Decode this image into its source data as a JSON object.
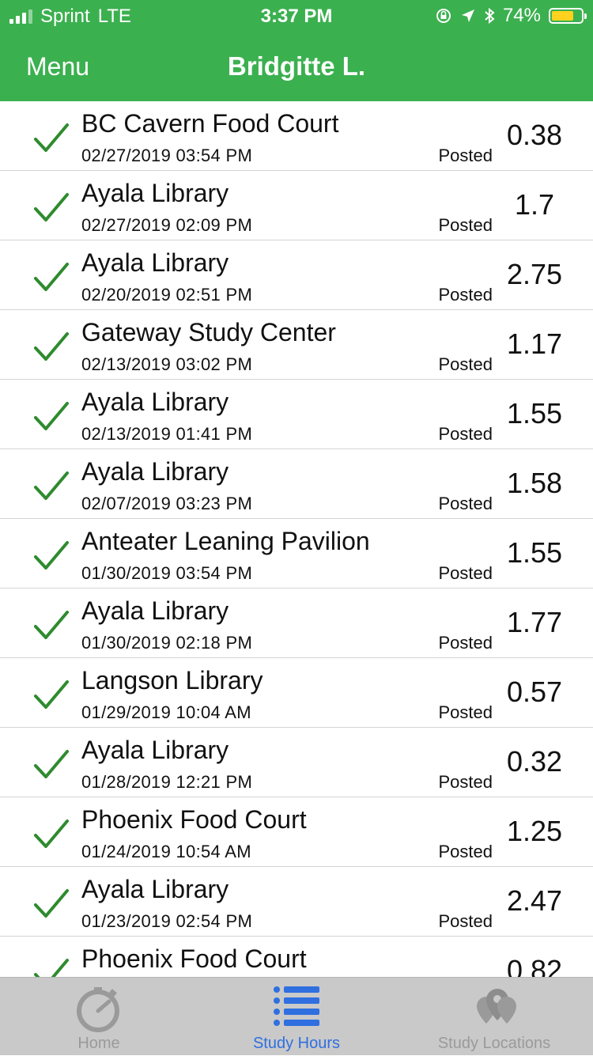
{
  "status_bar": {
    "carrier": "Sprint",
    "network": "LTE",
    "time": "3:37 PM",
    "battery": "74%",
    "battery_level": 0.74,
    "icons": [
      "signal-icon",
      "rotation-lock-icon",
      "location-arrow-icon",
      "bluetooth-icon",
      "battery-icon"
    ]
  },
  "nav": {
    "menu_label": "Menu",
    "title": "Bridgitte L."
  },
  "colors": {
    "brand_green": "#3bb04f",
    "check_green": "#2e8b2e",
    "active_tab": "#2f6fe0",
    "battery_yellow": "#ffd21f"
  },
  "entries": [
    {
      "location": "BC Cavern Food Court",
      "datetime": "02/27/2019 03:54 PM",
      "status": "Posted",
      "hours": "0.38"
    },
    {
      "location": "Ayala Library",
      "datetime": "02/27/2019 02:09 PM",
      "status": "Posted",
      "hours": "1.7"
    },
    {
      "location": "Ayala Library",
      "datetime": "02/20/2019 02:51 PM",
      "status": "Posted",
      "hours": "2.75"
    },
    {
      "location": "Gateway Study Center",
      "datetime": "02/13/2019 03:02 PM",
      "status": "Posted",
      "hours": "1.17"
    },
    {
      "location": "Ayala Library",
      "datetime": "02/13/2019 01:41 PM",
      "status": "Posted",
      "hours": "1.55"
    },
    {
      "location": "Ayala Library",
      "datetime": "02/07/2019 03:23 PM",
      "status": "Posted",
      "hours": "1.58"
    },
    {
      "location": "Anteater Leaning Pavilion",
      "datetime": "01/30/2019 03:54 PM",
      "status": "Posted",
      "hours": "1.55"
    },
    {
      "location": "Ayala Library",
      "datetime": "01/30/2019 02:18 PM",
      "status": "Posted",
      "hours": "1.77"
    },
    {
      "location": "Langson Library",
      "datetime": "01/29/2019 10:04 AM",
      "status": "Posted",
      "hours": "0.57"
    },
    {
      "location": "Ayala Library",
      "datetime": "01/28/2019 12:21 PM",
      "status": "Posted",
      "hours": "0.32"
    },
    {
      "location": "Phoenix Food Court",
      "datetime": "01/24/2019 10:54 AM",
      "status": "Posted",
      "hours": "1.25"
    },
    {
      "location": "Ayala Library",
      "datetime": "01/23/2019 02:54 PM",
      "status": "Posted",
      "hours": "2.47"
    },
    {
      "location": "Phoenix Food Court",
      "datetime": "",
      "status": "",
      "hours": "0.82"
    }
  ],
  "tabs": [
    {
      "label": "Home",
      "icon": "stopwatch-icon",
      "active": false
    },
    {
      "label": "Study Hours",
      "icon": "list-icon",
      "active": true
    },
    {
      "label": "Study Locations",
      "icon": "map-pins-icon",
      "active": false
    }
  ]
}
